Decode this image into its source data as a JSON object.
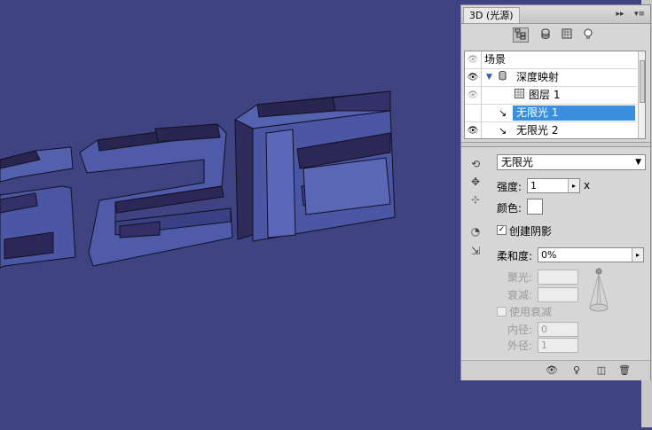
{
  "panel": {
    "tab_title": "3D (光源)",
    "menu_icon": "panel-menu-icon",
    "collapse_icon": "double-arrow-icon"
  },
  "toolbar": {
    "tools": [
      "scene-filter-icon",
      "mesh-filter-icon",
      "material-filter-icon",
      "light-filter-icon"
    ]
  },
  "scene_list": {
    "items": [
      {
        "label": "场景",
        "eye": "eye-dim"
      },
      {
        "label": "深度映射",
        "eye": "eye",
        "icon": "mesh-icon",
        "expanded": true
      },
      {
        "label": "图层 1",
        "eye": "eye-dim",
        "icon": "layer-icon"
      },
      {
        "label": "无限光 1",
        "eye": "eye",
        "icon": "infinite-light-icon",
        "selected": true
      },
      {
        "label": "无限光 2",
        "eye": "eye",
        "icon": "infinite-light-icon"
      }
    ]
  },
  "light": {
    "type_value": "无限光",
    "intensity_label": "强度:",
    "intensity_value": "1",
    "intensity_suffix": "x",
    "color_label": "颜色:",
    "color_value": "#ffffff",
    "create_shadows_label": "创建阴影",
    "create_shadows_checked": true,
    "softness_label": "柔和度:",
    "softness_value": "0%",
    "hotspot_label": "聚光:",
    "hotspot_value": "",
    "falloff_label": "衰减:",
    "falloff_value": "",
    "use_attenuation_label": "使用衰减",
    "use_attenuation_checked": false,
    "inner_label": "内径:",
    "inner_value": "0",
    "outer_label": "外径:",
    "outer_value": "1"
  },
  "bottom_bar": {
    "icons": [
      "toggle-lights-icon",
      "add-light-icon",
      "new-light-icon",
      "trash-icon"
    ]
  },
  "colors": {
    "canvas_bg": "#3f4382",
    "panel_bg": "#d6d6d6",
    "selection": "#3b8fe0",
    "glyph_face": "#4d58a8",
    "glyph_dark": "#2a2550"
  }
}
